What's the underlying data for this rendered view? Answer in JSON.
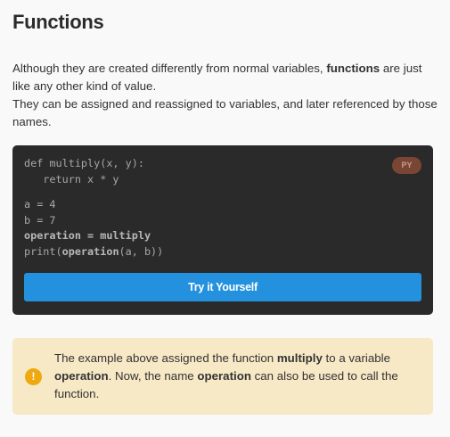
{
  "title": "Functions",
  "intro": {
    "p1_before": "Although they are created differently from normal variables, ",
    "p1_bold": "functions",
    "p1_after": " are just like any other kind of value.",
    "p2": "They can be assigned and reassigned to variables, and later referenced by those names."
  },
  "code": {
    "language_badge": "PY",
    "line1": "def multiply(x, y):",
    "line2": "   return x * y",
    "line3": "a = 4",
    "line4": "b = 7",
    "line5": "operation = multiply",
    "line6_a": "print(",
    "line6_b": "operation",
    "line6_c": "(a, b))",
    "try_button": "Try it Yourself",
    "colors": {
      "background": "#2a2a2a",
      "button": "#2391dd",
      "badge": "#7a4634"
    }
  },
  "note": {
    "icon": "exclamation-icon",
    "t1": "The example above assigned the function ",
    "b1": "multiply",
    "t2": " to a variable ",
    "b2": "operation",
    "t3": ". Now, the name ",
    "b3": "operation",
    "t4": " can also be used to call the function.",
    "colors": {
      "background": "#f7e8c6",
      "icon": "#eda90e"
    }
  }
}
